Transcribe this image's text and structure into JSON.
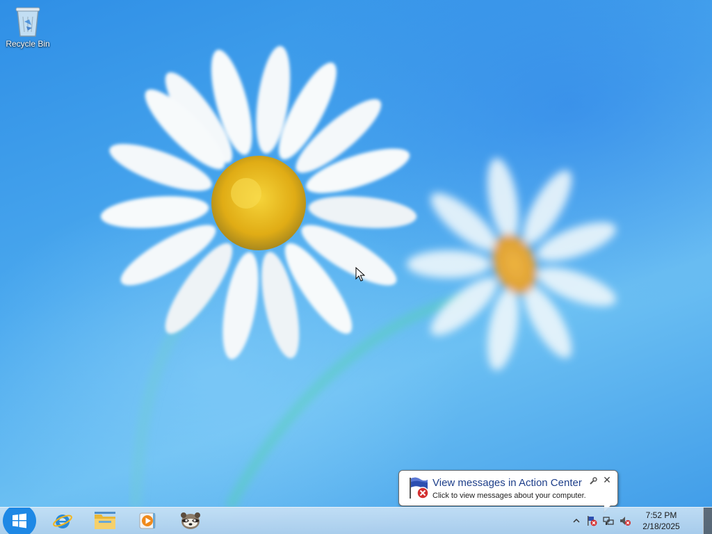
{
  "desktop": {
    "icons": [
      {
        "label": "Recycle Bin",
        "icon": "recycle-bin-icon"
      }
    ]
  },
  "notification": {
    "title": "View messages in Action Center",
    "message": "Click to view messages about your computer.",
    "icon": "action-center-flag-icon",
    "close_label": "✕"
  },
  "taskbar": {
    "start": "windows-logo-icon",
    "pinned": [
      {
        "name": "Internet Explorer",
        "icon": "internet-explorer-icon"
      },
      {
        "name": "File Explorer",
        "icon": "file-explorer-icon"
      },
      {
        "name": "Windows Media Player",
        "icon": "media-player-icon"
      },
      {
        "name": "Raccoon app",
        "icon": "raccoon-icon"
      }
    ],
    "tray": {
      "icons": [
        "show-hidden-icons-chevron-icon",
        "action-center-error-icon",
        "network-icon",
        "volume-muted-icon"
      ],
      "time": "7:52 PM",
      "date": "2/18/2025"
    }
  },
  "colors": {
    "desktop_blue": "#3d9ae8",
    "balloon_title": "#1e3f8a",
    "start_button": "#1e88e5"
  }
}
